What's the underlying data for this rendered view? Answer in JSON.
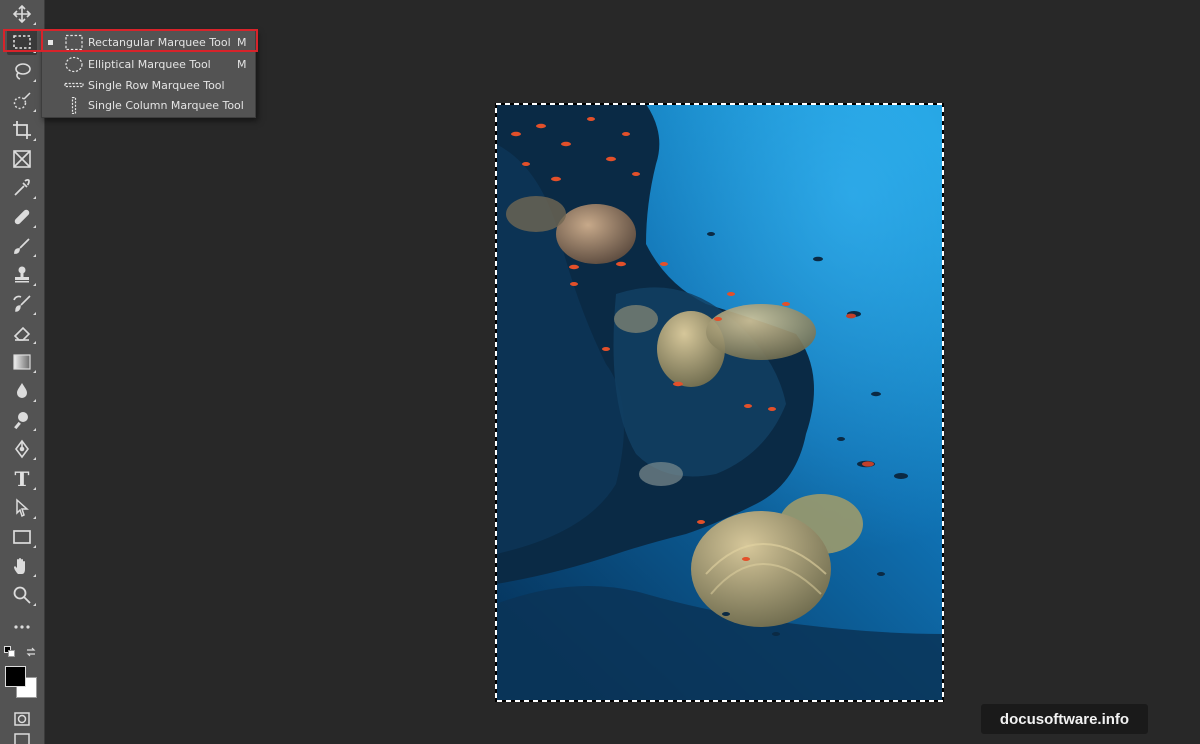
{
  "toolbar": {
    "tools": [
      {
        "name": "move",
        "icon": "move-icon"
      },
      {
        "name": "marquee",
        "icon": "rectangular-marquee-icon",
        "active": true
      },
      {
        "name": "lasso",
        "icon": "lasso-icon"
      },
      {
        "name": "quick-selection",
        "icon": "quick-selection-icon"
      },
      {
        "name": "crop",
        "icon": "crop-icon"
      },
      {
        "name": "frame",
        "icon": "frame-icon"
      },
      {
        "name": "eyedropper",
        "icon": "eyedropper-icon"
      },
      {
        "name": "healing-brush",
        "icon": "bandage-icon"
      },
      {
        "name": "brush",
        "icon": "brush-icon"
      },
      {
        "name": "clone-stamp",
        "icon": "stamp-icon"
      },
      {
        "name": "history-brush",
        "icon": "history-brush-icon"
      },
      {
        "name": "eraser",
        "icon": "eraser-icon"
      },
      {
        "name": "gradient",
        "icon": "gradient-icon"
      },
      {
        "name": "blur",
        "icon": "drop-icon"
      },
      {
        "name": "dodge",
        "icon": "dodge-icon"
      },
      {
        "name": "pen",
        "icon": "pen-icon"
      },
      {
        "name": "type",
        "icon": "type-icon"
      },
      {
        "name": "path-selection",
        "icon": "arrow-icon"
      },
      {
        "name": "rectangle",
        "icon": "rectangle-icon"
      },
      {
        "name": "hand",
        "icon": "hand-icon"
      },
      {
        "name": "zoom",
        "icon": "zoom-icon"
      },
      {
        "name": "edit-toolbar",
        "icon": "more-icon"
      }
    ],
    "type_glyph": "T",
    "foreground_color": "#000000",
    "background_color": "#ffffff"
  },
  "flyout": {
    "items": [
      {
        "label": "Rectangular Marquee Tool",
        "shortcut": "M",
        "icon": "rectangular-marquee-icon",
        "selected": true
      },
      {
        "label": "Elliptical Marquee Tool",
        "shortcut": "M",
        "icon": "elliptical-marquee-icon",
        "selected": false
      },
      {
        "label": "Single Row Marquee Tool",
        "shortcut": "",
        "icon": "single-row-marquee-icon",
        "selected": false
      },
      {
        "label": "Single Column Marquee Tool",
        "shortcut": "",
        "icon": "single-column-marquee-icon",
        "selected": false
      }
    ]
  },
  "canvas": {
    "content": "underwater-coral-reef-photo",
    "selection": "rectangular-marquee"
  },
  "watermark": {
    "text": "docusoftware.info"
  },
  "colors": {
    "ui_background": "#282828",
    "toolbar": "#535353",
    "highlight": "#d8232a"
  }
}
